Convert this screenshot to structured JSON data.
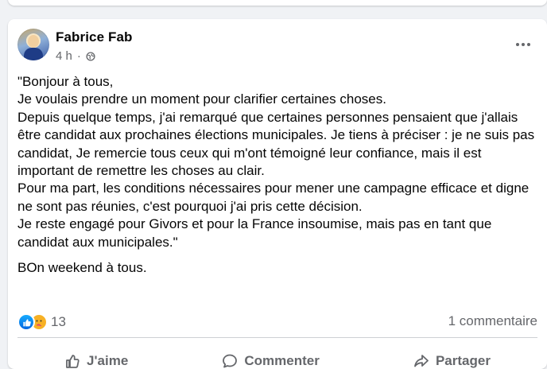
{
  "post": {
    "author": "Fabrice Fab",
    "time": "4 h",
    "separator": "·",
    "paragraph_lines": [
      "\"Bonjour à tous,",
      "Je voulais prendre un moment pour clarifier certaines choses.",
      "Depuis quelque temps, j'ai remarqué que certaines personnes pensaient que j'allais être candidat aux prochaines élections municipales. Je tiens à préciser : je ne suis pas candidat, Je remercie tous ceux qui m'ont témoigné leur confiance, mais il est important de remettre les choses au clair.",
      "Pour ma part, les conditions nécessaires pour mener une campagne efficace et digne ne sont pas réunies, c'est pourquoi j'ai pris cette décision.",
      "Je reste engagé pour Givors et pour la France insoumise, mais pas en tant que candidat aux municipales.\""
    ],
    "closing": "BOn weekend à tous."
  },
  "engagement": {
    "reaction_count": "13",
    "comments": "1 commentaire"
  },
  "actions": {
    "like": "J'aime",
    "comment": "Commenter",
    "share": "Partager"
  },
  "icons": {
    "audience": "globe-icon",
    "menu": "more-horizontal-icon",
    "reaction_1": "like-reaction-icon",
    "reaction_2": "care-reaction-icon"
  },
  "colors": {
    "background": "#f0f2f5",
    "card": "#ffffff",
    "text": "#050505",
    "secondary_text": "#65676b",
    "like_blue": "#0866ff"
  }
}
